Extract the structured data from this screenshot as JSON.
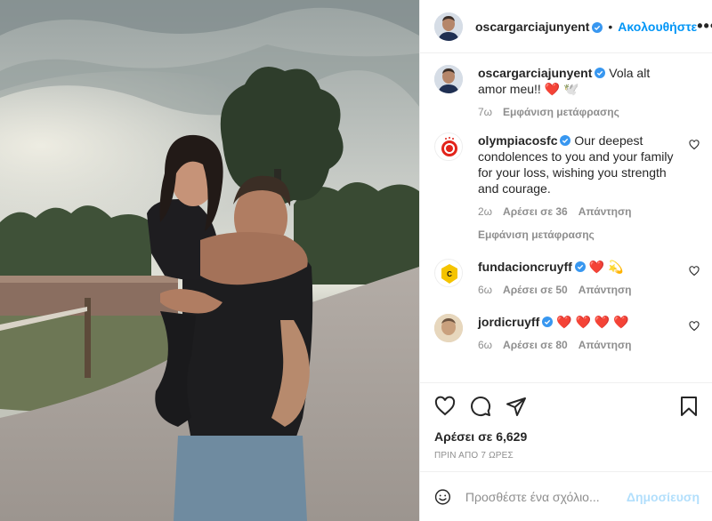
{
  "post": {
    "author": "oscargarciajunyent",
    "follow_label": "Ακολουθήστε",
    "dot": "•",
    "more_label": "•••",
    "likes_text": "Αρέσει σε 6,629",
    "timestamp": "ΠΡΙΝ ΑΠΟ 7 ΩΡΕΣ"
  },
  "caption": {
    "user": "oscargarciajunyent",
    "text": "Vola alt amor meu!!",
    "emoji": "❤️",
    "emoji2": "🕊️",
    "age": "7ω",
    "translate": "Εμφάνιση μετάφρασης"
  },
  "comments": [
    {
      "user": "olympiacosfc",
      "text": "Our deepest condolences to you and your family for your loss, wishing you strength and courage.",
      "age": "2ω",
      "likes": "Αρέσει σε 36",
      "reply": "Απάντηση",
      "translate": "Εμφάνιση μετάφρασης"
    },
    {
      "user": "fundacioncruyff",
      "text": "",
      "emoji": "❤️",
      "emoji2": "💫",
      "age": "6ω",
      "likes": "Αρέσει σε 50",
      "reply": "Απάντηση"
    },
    {
      "user": "jordicruyff",
      "text": "",
      "emoji": "❤️ ❤️ ❤️ ❤️",
      "age": "6ω",
      "likes": "Αρέσει σε 80",
      "reply": "Απάντηση"
    }
  ],
  "comment_box": {
    "placeholder": "Προσθέστε ένα σχόλιο...",
    "post_label": "Δημοσίευση"
  },
  "icons": [
    "heart-icon",
    "comment-icon",
    "share-icon",
    "bookmark-icon",
    "emoji-icon",
    "verified-badge-icon",
    "more-options-icon"
  ],
  "colors": {
    "accent": "#0095f6",
    "verified": "#3897f0",
    "post_disabled": "#b2dffc",
    "muted": "#8e8e8e"
  }
}
